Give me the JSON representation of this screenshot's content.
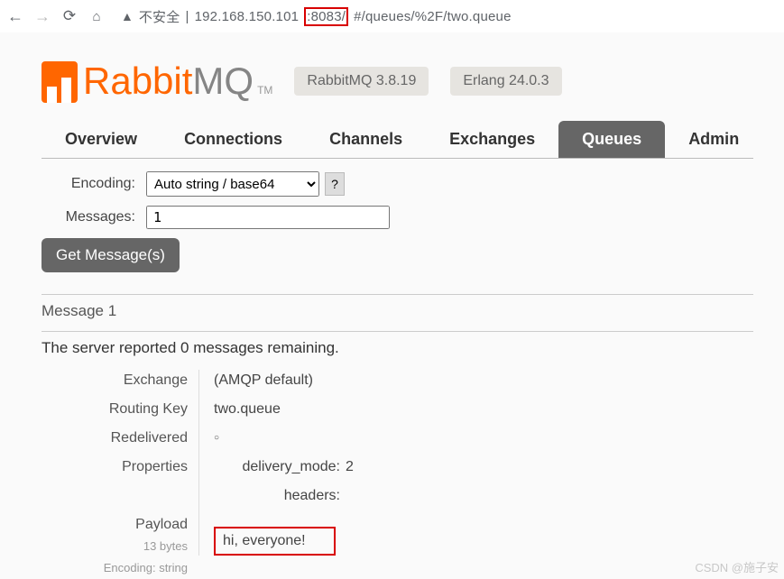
{
  "browser": {
    "security_label": "不安全",
    "url_host": "192.168.150.101",
    "url_port": ":8083/",
    "url_path": "#/queues/%2F/two.queue"
  },
  "logo": {
    "text1": "Rabbit",
    "text2": "MQ",
    "tm": "TM"
  },
  "badges": {
    "version": "RabbitMQ 3.8.19",
    "erlang": "Erlang 24.0.3"
  },
  "tabs": [
    "Overview",
    "Connections",
    "Channels",
    "Exchanges",
    "Queues",
    "Admin"
  ],
  "active_tab": "Queues",
  "form": {
    "encoding_label": "Encoding:",
    "encoding_value": "Auto string / base64",
    "help": "?",
    "messages_label": "Messages:",
    "messages_value": "1",
    "submit": "Get Message(s)"
  },
  "result": {
    "title": "Message 1",
    "remaining": "The server reported 0 messages remaining.",
    "rows": {
      "exchange_label": "Exchange",
      "exchange_value": "(AMQP default)",
      "routing_label": "Routing Key",
      "routing_value": "two.queue",
      "redelivered_label": "Redelivered",
      "redelivered_value": "○",
      "properties_label": "Properties",
      "prop_delivery_label": "delivery_mode:",
      "prop_delivery_value": "2",
      "prop_headers_label": "headers:",
      "payload_label": "Payload",
      "payload_size": "13 bytes",
      "payload_encoding": "Encoding: string",
      "payload_value": "hi, everyone!"
    }
  },
  "watermark": "CSDN @施子安"
}
